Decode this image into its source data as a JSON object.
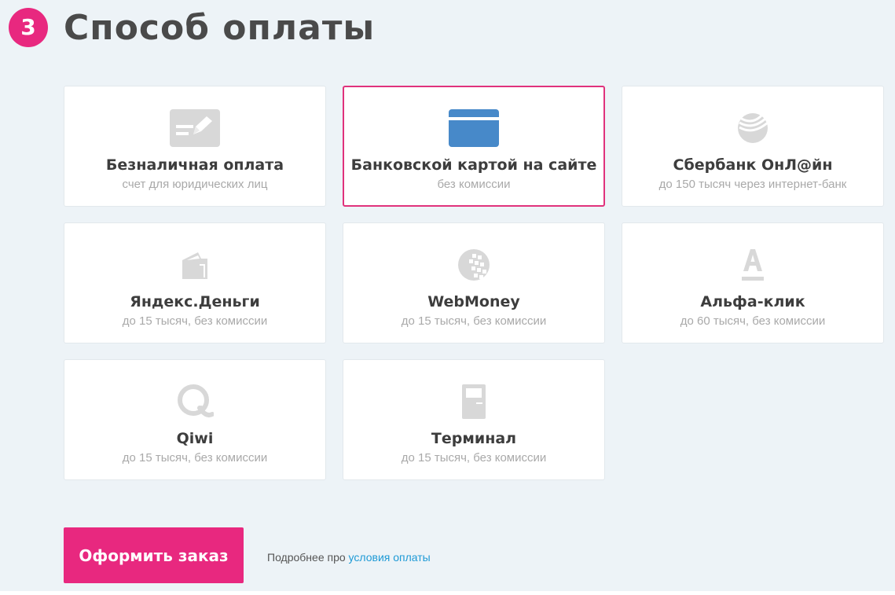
{
  "step": {
    "number": "3",
    "title": "Способ оплаты"
  },
  "methods": [
    {
      "name": "Безналичная оплата",
      "note": "счет для юридических лиц",
      "icon": "invoice-icon",
      "selected": false
    },
    {
      "name": "Банковской картой на сайте",
      "note": "без комиссии",
      "icon": "bank-card-icon",
      "selected": true
    },
    {
      "name": "Сбербанк ОнЛ@йн",
      "note": "до 150 тысяч через интернет-банк",
      "icon": "sberbank-icon",
      "selected": false
    },
    {
      "name": "Яндекс.Деньги",
      "note": "до 15 тысяч, без комиссии",
      "icon": "yandex-money-icon",
      "selected": false
    },
    {
      "name": "WebMoney",
      "note": "до 15 тысяч, без комиссии",
      "icon": "webmoney-icon",
      "selected": false
    },
    {
      "name": "Альфа-клик",
      "note": "до 60 тысяч, без комиссии",
      "icon": "alfa-click-icon",
      "selected": false
    },
    {
      "name": "Qiwi",
      "note": "до 15 тысяч, без комиссии",
      "icon": "qiwi-icon",
      "selected": false
    },
    {
      "name": "Терминал",
      "note": "до 15 тысяч, без комиссии",
      "icon": "terminal-icon",
      "selected": false
    }
  ],
  "actions": {
    "submit_label": "Оформить заказ",
    "more_info_prefix": "Подробнее про",
    "more_info_link": "условия оплаты"
  },
  "colors": {
    "accent": "#e8287f",
    "selected_border": "#e0327c",
    "link": "#1e9ad6",
    "card_icon_active": "#4789c9",
    "card_icon_inactive": "#d8d8d8",
    "background": "#edf3f7"
  }
}
